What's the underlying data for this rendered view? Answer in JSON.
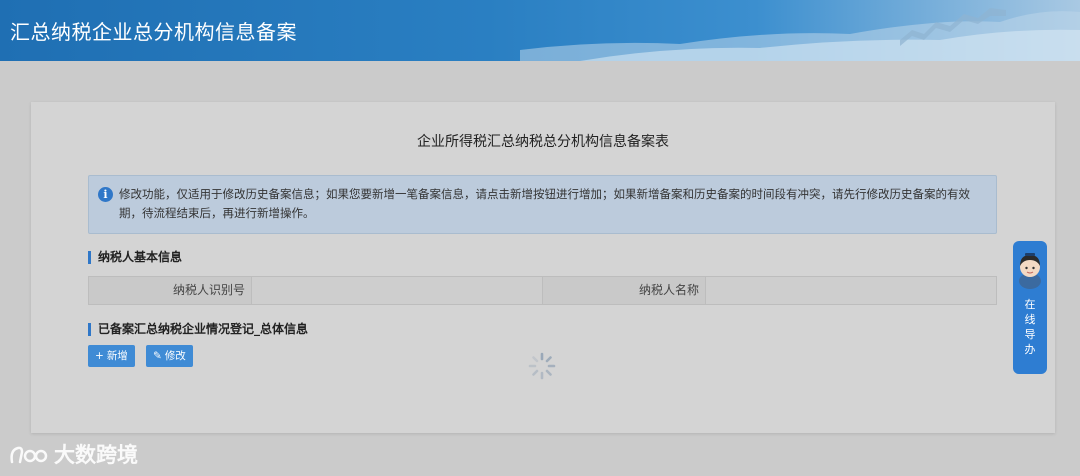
{
  "header": {
    "title": "汇总纳税企业总分机构信息备案"
  },
  "form": {
    "title": "企业所得税汇总纳税总分机构信息备案表"
  },
  "notice": {
    "icon": "info-icon",
    "text": "修改功能，仅适用于修改历史备案信息；如果您要新增一笔备案信息，请点击新增按钮进行增加；如果新增备案和历史备案的时间段有冲突，请先行修改历史备案的有效期，待流程结束后，再进行新增操作。"
  },
  "taxpayer_section": {
    "title": "纳税人基本信息",
    "id_label": "纳税人识别号",
    "id_value": "",
    "name_label": "纳税人名称",
    "name_value": ""
  },
  "filed_section": {
    "title": "已备案汇总纳税企业情况登记_总体信息",
    "add_label": "新增",
    "edit_label": "修改"
  },
  "side_widget": {
    "label": "在\n线\n导\n办"
  },
  "watermark": {
    "text": "大数跨境"
  },
  "colors": {
    "primary": "#2f77c8",
    "header": "#2a7fc2",
    "overlay": "#cbcbcb"
  }
}
